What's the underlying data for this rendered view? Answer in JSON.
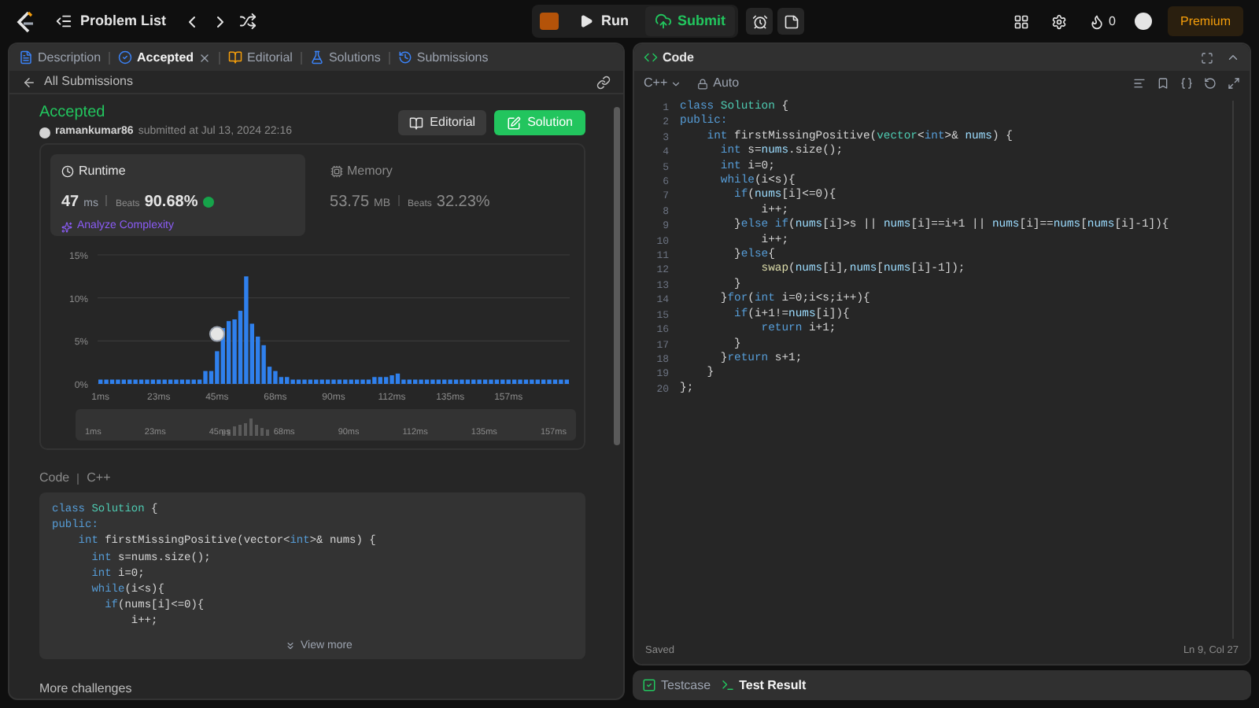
{
  "top_bar": {
    "title": "Problem List",
    "run": "Run",
    "submit": "Submit",
    "streak": "0",
    "premium": "Premium"
  },
  "tabs": [
    {
      "label": "Description",
      "selected": false,
      "closable": false,
      "kind": "doc"
    },
    {
      "label": "Accepted",
      "selected": true,
      "closable": true,
      "kind": "accepted"
    },
    {
      "label": "Editorial",
      "selected": false,
      "closable": false,
      "kind": "book"
    },
    {
      "label": "Solutions",
      "selected": false,
      "closable": false,
      "kind": "flask"
    },
    {
      "label": "Submissions",
      "selected": false,
      "closable": false,
      "kind": "history"
    }
  ],
  "back_link": "All Submissions",
  "submission": {
    "status": "Accepted",
    "user": "ramankumar86",
    "submitted": "submitted at Jul 13, 2024 22:16",
    "editorial_button": "Editorial",
    "solution_button": "Solution"
  },
  "runtime": {
    "label": "Runtime",
    "value": "47",
    "unit": "ms",
    "beats_label": "Beats",
    "beats": "90.68%",
    "analyze": "Analyze Complexity",
    "selected": true
  },
  "memory": {
    "label": "Memory",
    "value": "53.75",
    "unit": "MB",
    "beats_label": "Beats",
    "beats": "32.23%",
    "selected": false
  },
  "chart_data": {
    "type": "bar",
    "ylim": [
      0,
      15
    ],
    "yticks": [
      {
        "value": 0,
        "label": "0%"
      },
      {
        "value": 5,
        "label": "5%"
      },
      {
        "value": 10,
        "label": "10%"
      },
      {
        "value": 15,
        "label": "15%"
      }
    ],
    "categories": [
      "1ms",
      null,
      null,
      null,
      null,
      null,
      null,
      null,
      null,
      null,
      "23ms",
      null,
      null,
      null,
      null,
      null,
      null,
      null,
      null,
      null,
      "45ms",
      null,
      null,
      null,
      null,
      null,
      null,
      null,
      null,
      null,
      "68ms",
      null,
      null,
      null,
      null,
      null,
      null,
      null,
      null,
      null,
      "90ms",
      null,
      null,
      null,
      null,
      null,
      null,
      null,
      null,
      null,
      "112ms",
      null,
      null,
      null,
      null,
      null,
      null,
      null,
      null,
      null,
      "135ms",
      null,
      null,
      null,
      null,
      null,
      null,
      null,
      null,
      null,
      "157ms",
      null,
      null,
      null,
      null,
      null,
      null,
      null,
      null,
      null,
      null
    ],
    "values": [
      0.5,
      0.5,
      0.5,
      0.5,
      0.5,
      0.5,
      0.5,
      0.5,
      0.5,
      0.5,
      0.5,
      0.5,
      0.5,
      0.5,
      0.5,
      0.5,
      0.5,
      0.5,
      1.5,
      1.5,
      3.8,
      6.5,
      7.3,
      7.5,
      8.5,
      12.5,
      7,
      5.5,
      4.5,
      2,
      1.5,
      0.8,
      0.8,
      0.5,
      0.5,
      0.5,
      0.5,
      0.5,
      0.5,
      0.5,
      0.5,
      0.5,
      0.5,
      0.5,
      0.5,
      0.5,
      0.5,
      0.8,
      0.8,
      0.8,
      1,
      1.2,
      0.5,
      0.5,
      0.5,
      0.5,
      0.5,
      0.5,
      0.5,
      0.5,
      0.5,
      0.5,
      0.5,
      0.5,
      0.5,
      0.5,
      0.5,
      0.5,
      0.5,
      0.5,
      0.5,
      0.5,
      0.5,
      0.5,
      0.5,
      0.5,
      0.5,
      0.5,
      0.5,
      0.5,
      0.5
    ]
  },
  "range_labels": [
    "1ms",
    "23ms",
    "45ms",
    "68ms",
    "90ms",
    "112ms",
    "135ms",
    "157ms"
  ],
  "code_preview": {
    "label": "Code",
    "language": "C++",
    "view_more": "View more",
    "lines": [
      [
        {
          "text": "class ",
          "kind": "kw"
        },
        {
          "text": "Solution",
          "kind": "type"
        },
        {
          "text": " {",
          "kind": "p"
        }
      ],
      [
        {
          "text": "public:",
          "kind": "kw"
        }
      ],
      [
        {
          "text": "    int ",
          "kind": "kw"
        },
        {
          "text": "firstMissingPositive(vector<",
          "kind": "p"
        },
        {
          "text": "int",
          "kind": "kw"
        },
        {
          "text": ">& nums) {",
          "kind": "p"
        }
      ],
      [
        {
          "text": "      int ",
          "kind": "kw"
        },
        {
          "text": "s=nums.size();",
          "kind": "p"
        }
      ],
      [
        {
          "text": "      int ",
          "kind": "kw"
        },
        {
          "text": "i=0;",
          "kind": "p"
        }
      ],
      [
        {
          "text": "      while",
          "kind": "kw"
        },
        {
          "text": "(i<s){",
          "kind": "p"
        }
      ],
      [
        {
          "text": "        if",
          "kind": "kw"
        },
        {
          "text": "(nums[i]<=0){",
          "kind": "p"
        }
      ],
      [
        {
          "text": "            i++;",
          "kind": "p"
        }
      ]
    ]
  },
  "more_challenges": "More challenges",
  "editor": {
    "title": "Code",
    "language": "C++",
    "mode": "Auto",
    "status": "Saved",
    "cursor": "Ln 9, Col 27",
    "lines": [
      {
        "number": "1",
        "tokens": [
          {
            "text": "class ",
            "kind": "kw"
          },
          {
            "text": "Solution",
            "kind": "type"
          },
          {
            "text": " {",
            "kind": "p"
          }
        ]
      },
      {
        "number": "2",
        "tokens": [
          {
            "text": "public:",
            "kind": "kw"
          }
        ]
      },
      {
        "number": "3",
        "tokens": [
          {
            "text": "    int ",
            "kind": "kw"
          },
          {
            "text": "firstMissingPositive(",
            "kind": "p"
          },
          {
            "text": "vector",
            "kind": "type"
          },
          {
            "text": "<",
            "kind": "p"
          },
          {
            "text": "int",
            "kind": "kw"
          },
          {
            "text": ">& ",
            "kind": "p"
          },
          {
            "text": "nums",
            "kind": "var"
          },
          {
            "text": ") {",
            "kind": "p"
          }
        ]
      },
      {
        "number": "4",
        "tokens": [
          {
            "text": "      int ",
            "kind": "kw"
          },
          {
            "text": "s=",
            "kind": "p"
          },
          {
            "text": "nums",
            "kind": "var"
          },
          {
            "text": ".size();",
            "kind": "p"
          }
        ]
      },
      {
        "number": "5",
        "tokens": [
          {
            "text": "      int ",
            "kind": "kw"
          },
          {
            "text": "i=0;",
            "kind": "p"
          }
        ]
      },
      {
        "number": "6",
        "tokens": [
          {
            "text": "      while",
            "kind": "kw"
          },
          {
            "text": "(i<s){",
            "kind": "p"
          }
        ]
      },
      {
        "number": "7",
        "tokens": [
          {
            "text": "        if",
            "kind": "kw"
          },
          {
            "text": "(",
            "kind": "p"
          },
          {
            "text": "nums",
            "kind": "var"
          },
          {
            "text": "[i]<=0){",
            "kind": "p"
          }
        ]
      },
      {
        "number": "8",
        "tokens": [
          {
            "text": "            i++;",
            "kind": "p"
          }
        ]
      },
      {
        "number": "9",
        "tokens": [
          {
            "text": "        }",
            "kind": "p"
          },
          {
            "text": "else if",
            "kind": "kw"
          },
          {
            "text": "(",
            "kind": "p"
          },
          {
            "text": "nums",
            "kind": "var"
          },
          {
            "text": "[i]>s || ",
            "kind": "p"
          },
          {
            "text": "nums",
            "kind": "var"
          },
          {
            "text": "[i]==i+1 || ",
            "kind": "p"
          },
          {
            "text": "nums",
            "kind": "var"
          },
          {
            "text": "[i]==",
            "kind": "p"
          },
          {
            "text": "nums",
            "kind": "var"
          },
          {
            "text": "[",
            "kind": "p"
          },
          {
            "text": "nums",
            "kind": "var"
          },
          {
            "text": "[i]-1]){",
            "kind": "p"
          }
        ]
      },
      {
        "number": "10",
        "tokens": [
          {
            "text": "            i++;",
            "kind": "p"
          }
        ]
      },
      {
        "number": "11",
        "tokens": [
          {
            "text": "        }",
            "kind": "p"
          },
          {
            "text": "else",
            "kind": "kw"
          },
          {
            "text": "{",
            "kind": "p"
          }
        ]
      },
      {
        "number": "12",
        "tokens": [
          {
            "text": "            swap",
            "kind": "fn"
          },
          {
            "text": "(",
            "kind": "p"
          },
          {
            "text": "nums",
            "kind": "var"
          },
          {
            "text": "[i],",
            "kind": "p"
          },
          {
            "text": "nums",
            "kind": "var"
          },
          {
            "text": "[",
            "kind": "p"
          },
          {
            "text": "nums",
            "kind": "var"
          },
          {
            "text": "[i]-1]);",
            "kind": "p"
          }
        ]
      },
      {
        "number": "13",
        "tokens": [
          {
            "text": "        }",
            "kind": "p"
          }
        ]
      },
      {
        "number": "14",
        "tokens": [
          {
            "text": "      }",
            "kind": "p"
          },
          {
            "text": "for",
            "kind": "kw"
          },
          {
            "text": "(",
            "kind": "p"
          },
          {
            "text": "int ",
            "kind": "kw"
          },
          {
            "text": "i=0;i<s;i++){",
            "kind": "p"
          }
        ]
      },
      {
        "number": "15",
        "tokens": [
          {
            "text": "        if",
            "kind": "kw"
          },
          {
            "text": "(i+1!=",
            "kind": "p"
          },
          {
            "text": "nums",
            "kind": "var"
          },
          {
            "text": "[i]){",
            "kind": "p"
          }
        ]
      },
      {
        "number": "16",
        "tokens": [
          {
            "text": "            return ",
            "kind": "kw"
          },
          {
            "text": "i+1;",
            "kind": "p"
          }
        ]
      },
      {
        "number": "17",
        "tokens": [
          {
            "text": "        }",
            "kind": "p"
          }
        ]
      },
      {
        "number": "18",
        "tokens": [
          {
            "text": "      }",
            "kind": "p"
          },
          {
            "text": "return ",
            "kind": "kw"
          },
          {
            "text": "s+1;",
            "kind": "p"
          }
        ]
      },
      {
        "number": "19",
        "tokens": [
          {
            "text": "    }",
            "kind": "p"
          }
        ]
      },
      {
        "number": "20",
        "tokens": [
          {
            "text": "};",
            "kind": "p"
          }
        ]
      }
    ]
  },
  "bottom_tabs": [
    {
      "label": "Testcase",
      "selected": false,
      "kind": "check"
    },
    {
      "label": "Test Result",
      "selected": true,
      "kind": "terminal"
    }
  ]
}
